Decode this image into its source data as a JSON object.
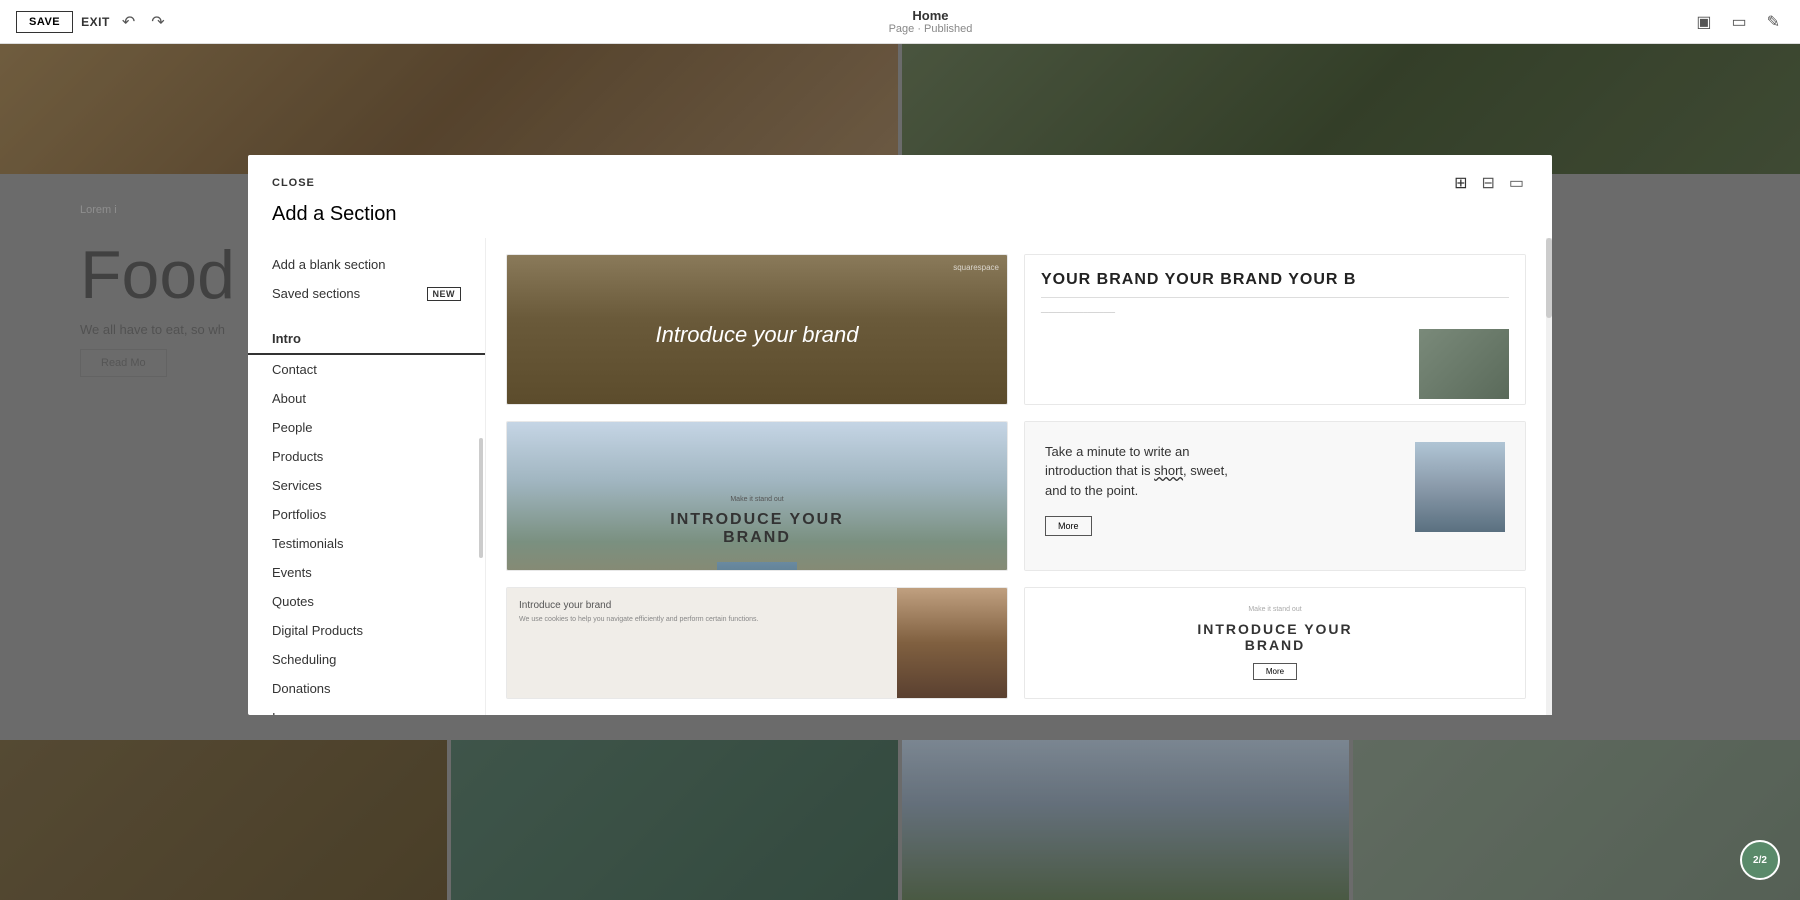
{
  "topbar": {
    "save_label": "SAVE",
    "exit_label": "EXIT",
    "page_title": "Home",
    "page_subtitle": "Page · Published"
  },
  "modal": {
    "close_label": "CLOSE",
    "title": "Add a Section",
    "sidebar": {
      "add_blank": "Add a blank section",
      "saved_sections": "Saved sections",
      "saved_sections_badge": "NEW",
      "nav_items": [
        {
          "label": "Intro",
          "active": true
        },
        {
          "label": "Contact",
          "active": false
        },
        {
          "label": "About",
          "active": false
        },
        {
          "label": "People",
          "active": false
        },
        {
          "label": "Products",
          "active": false
        },
        {
          "label": "Services",
          "active": false
        },
        {
          "label": "Portfolios",
          "active": false
        },
        {
          "label": "Testimonials",
          "active": false
        },
        {
          "label": "Events",
          "active": false
        },
        {
          "label": "Quotes",
          "active": false
        },
        {
          "label": "Digital Products",
          "active": false
        },
        {
          "label": "Scheduling",
          "active": false
        },
        {
          "label": "Donations",
          "active": false
        },
        {
          "label": "Images",
          "active": false
        }
      ]
    },
    "templates": [
      {
        "id": 1,
        "type": "dark-hero",
        "label": "Introduce your brand",
        "small_text": "squarespace"
      },
      {
        "id": 2,
        "type": "text-image",
        "title": "YOUR BRAND  YOUR BRAND  YOUR B",
        "sub": ""
      },
      {
        "id": 3,
        "type": "mountain-hero",
        "small_text": "Make it stand out",
        "title": "INTRODUCE YOUR\nBRAND"
      },
      {
        "id": 4,
        "type": "text-side-image",
        "body": "Take a minute to write an introduction that is short, sweet, and to the point.",
        "circle_word": "short",
        "button_label": "More"
      },
      {
        "id": 5,
        "type": "split-intro",
        "title": "Introduce your brand",
        "body": "We use cookies to help you navigate efficiently and perform certain functions."
      },
      {
        "id": 6,
        "type": "centered-white",
        "small_text": "Make it stand out",
        "title": "INTRODUCE YOUR\nBRAND",
        "button_label": "More"
      }
    ]
  },
  "page_bg": {
    "food_title": "Food",
    "food_subtitle": "We all have to eat, so wh",
    "read_more": "Read Mo",
    "lorem": "Lorem i"
  },
  "notification": {
    "label": "2/2"
  }
}
